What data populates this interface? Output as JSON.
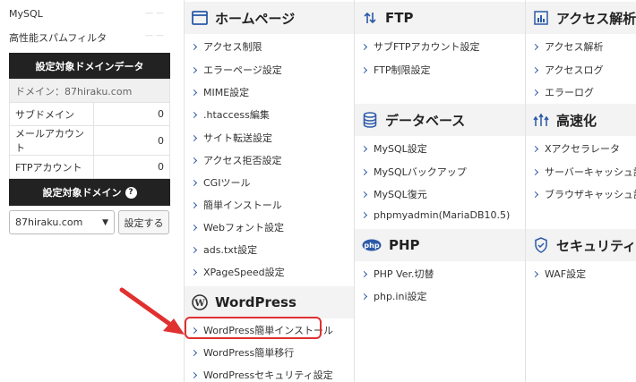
{
  "sidebar": {
    "mysql_label": "MySQL",
    "spam_label": "高性能スパムフィルタ",
    "domain_data_title": "設定対象ドメインデータ",
    "domain_label": "ドメイン：87hiraku.com",
    "rows": [
      {
        "label": "サブドメイン",
        "value": "0"
      },
      {
        "label": "メールアカウント",
        "value": "0"
      },
      {
        "label": "FTPアカウント",
        "value": "0"
      }
    ],
    "domain_select_title": "設定対象ドメイン",
    "help_glyph": "?",
    "selected_domain": "87hiraku.com",
    "set_button": "設定する"
  },
  "sections": {
    "homepage": {
      "title": "ホームページ",
      "items": [
        "アクセス制限",
        "エラーページ設定",
        "MIME設定",
        ".htaccess編集",
        "サイト転送設定",
        "アクセス拒否設定",
        "CGIツール",
        "簡単インストール",
        "Webフォント設定",
        "ads.txt設定",
        "XPageSpeed設定"
      ]
    },
    "wordpress": {
      "title": "WordPress",
      "items": [
        "WordPress簡単インストール",
        "WordPress簡単移行",
        "WordPressセキュリティ設定"
      ]
    },
    "ftp": {
      "title": "FTP",
      "items": [
        "サブFTPアカウント設定",
        "FTP制限設定"
      ]
    },
    "database": {
      "title": "データベース",
      "items": [
        "MySQL設定",
        "MySQLバックアップ",
        "MySQL復元",
        "phpmyadmin(MariaDB10.5)"
      ]
    },
    "php": {
      "title": "PHP",
      "icon_text": "php",
      "items": [
        "PHP Ver.切替",
        "php.ini設定"
      ]
    },
    "access": {
      "title": "アクセス解析",
      "items": [
        "アクセス解析",
        "アクセスログ",
        "エラーログ"
      ]
    },
    "speed": {
      "title": "高速化",
      "items": [
        "Xアクセラレータ",
        "サーバーキャッシュ設定",
        "ブラウザキャッシュ設定"
      ]
    },
    "security": {
      "title": "セキュリティ",
      "items": [
        "WAF設定"
      ]
    }
  },
  "colors": {
    "highlight": "#e03030",
    "link_chevron": "#2b5aa8",
    "header_bg": "#f3f3f3",
    "panel_bg": "#222222"
  }
}
